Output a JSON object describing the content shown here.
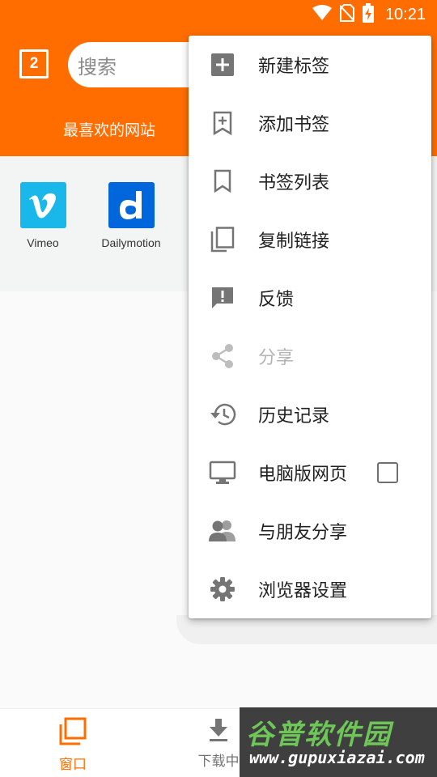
{
  "status_bar": {
    "time": "10:21",
    "icons": [
      "wifi-icon",
      "no-sim-icon",
      "battery-charging-icon"
    ]
  },
  "header": {
    "tab_count": "2",
    "search_placeholder": "搜索",
    "section_title": "最喜欢的网站",
    "accent_color": "#ff6d00"
  },
  "favorites": [
    {
      "label": "Vimeo",
      "icon": "vimeo-logo",
      "color": "#1ab7ea"
    },
    {
      "label": "Dailymotion",
      "icon": "dailymotion-logo",
      "color": "#0066dc"
    }
  ],
  "menu": {
    "items": [
      {
        "label": "新建标签",
        "icon": "add-tab-icon",
        "enabled": true
      },
      {
        "label": "添加书签",
        "icon": "add-bookmark-icon",
        "enabled": true
      },
      {
        "label": "书签列表",
        "icon": "bookmark-icon",
        "enabled": true
      },
      {
        "label": "复制链接",
        "icon": "copy-icon",
        "enabled": true
      },
      {
        "label": "反馈",
        "icon": "feedback-icon",
        "enabled": true
      },
      {
        "label": "分享",
        "icon": "share-icon",
        "enabled": false
      },
      {
        "label": "历史记录",
        "icon": "history-icon",
        "enabled": true
      },
      {
        "label": "电脑版网页",
        "icon": "desktop-icon",
        "enabled": true,
        "checked": false
      },
      {
        "label": "与朋友分享",
        "icon": "people-icon",
        "enabled": true
      },
      {
        "label": "浏览器设置",
        "icon": "settings-icon",
        "enabled": true
      }
    ]
  },
  "bottom_nav": {
    "items": [
      {
        "label": "窗口",
        "icon": "windows-icon",
        "active": true
      },
      {
        "label": "下载中",
        "icon": "download-icon",
        "active": false
      }
    ]
  },
  "watermark": {
    "title": "谷普软件园",
    "url": "www.gupuxiazai.com"
  }
}
